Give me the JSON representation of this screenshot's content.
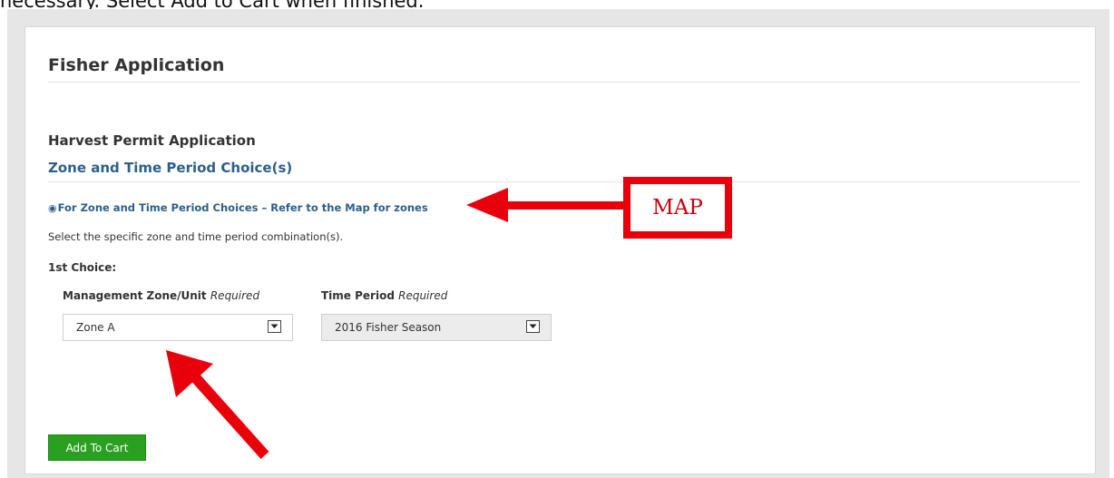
{
  "top_instruction": "necessary. Select Add to Cart when finished.",
  "form": {
    "title": "Fisher Application",
    "section_title": "Harvest Permit Application",
    "subsection_title": "Zone and Time Period Choice(s)",
    "map_link": "For Zone and Time Period Choices – Refer to the Map for zones",
    "hint": "Select the specific zone and time period combination(s).",
    "choice_label": "1st Choice:",
    "zone": {
      "label": "Management Zone/Unit",
      "required": "Required",
      "value": "Zone A"
    },
    "period": {
      "label": "Time Period",
      "required": "Required",
      "value": "2016 Fisher Season"
    },
    "add_button": "Add To Cart"
  },
  "annotation": {
    "map_label": "MAP",
    "color": "#e8000b"
  },
  "icons": [
    "eye-icon",
    "chevron-down-icon"
  ]
}
